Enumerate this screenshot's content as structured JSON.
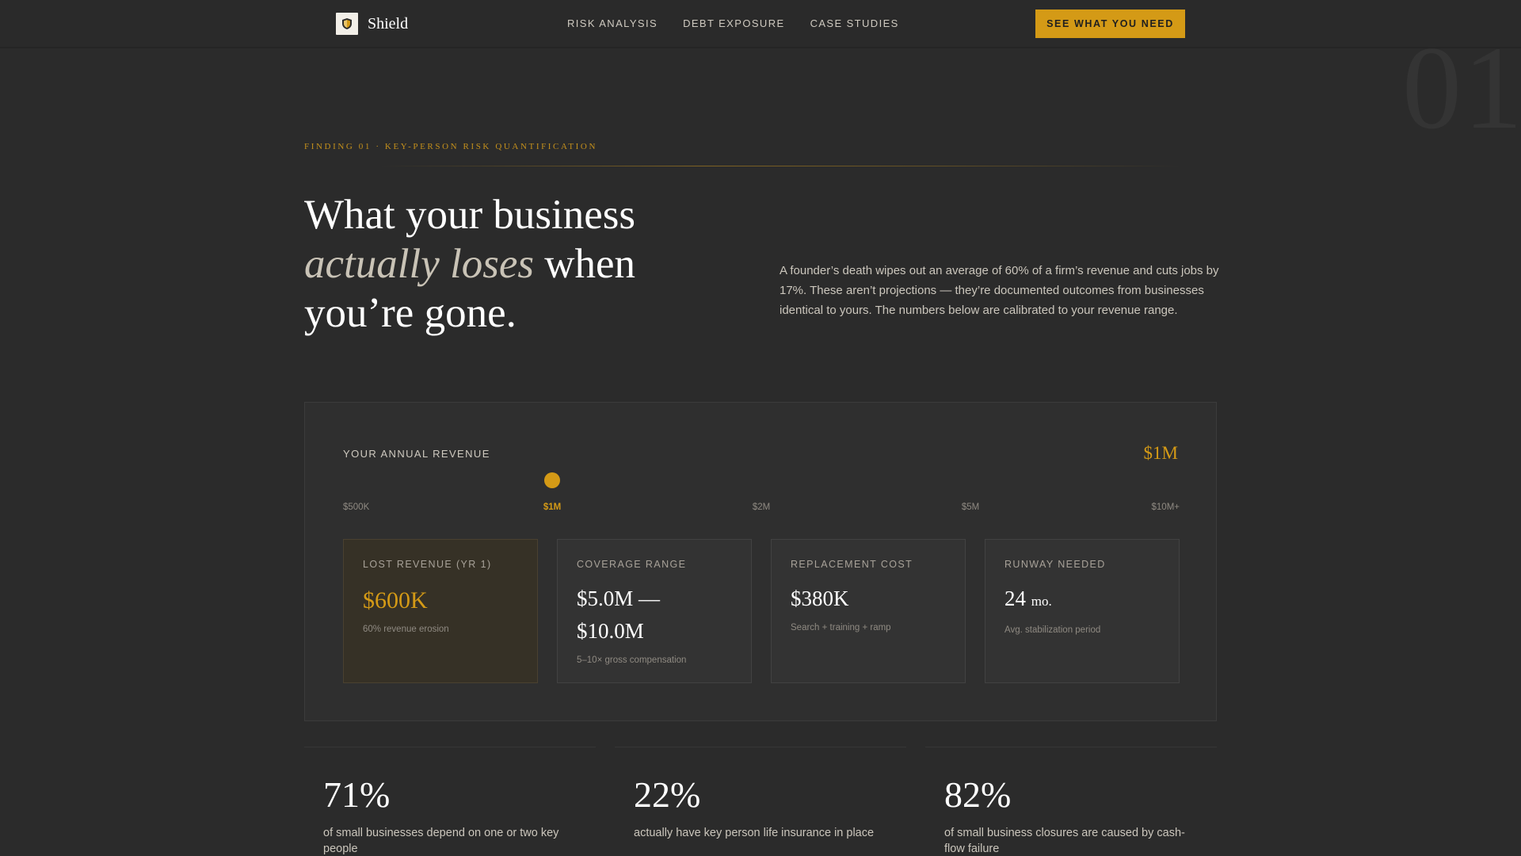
{
  "nav": {
    "brand": "Shield",
    "links": [
      "RISK ANALYSIS",
      "DEBT EXPOSURE",
      "CASE STUDIES"
    ],
    "cta": "SEE WHAT YOU NEED"
  },
  "ghost_number": "01",
  "section": {
    "eyebrow": "FINDING 01 · KEY-PERSON RISK QUANTIFICATION",
    "headline": {
      "line1": "What your business",
      "em": "actually loses",
      "line2_rest": " when",
      "line3": "you’re gone."
    },
    "intro": "A founder’s death wipes out an average of 60% of a firm’s revenue and cuts jobs by 17%. These aren’t projections — they’re documented outcomes from businesses identical to yours. The numbers below are calibrated to your revenue range."
  },
  "calculator": {
    "label": "YOUR ANNUAL REVENUE",
    "value": "$1M",
    "slider_position": 0.25,
    "ticks": [
      "$500K",
      "$1M",
      "$2M",
      "$5M",
      "$10M+"
    ],
    "active_tick": 1,
    "accent_color": "#d49a16",
    "cards": [
      {
        "label": "LOST REVENUE (YR 1)",
        "value": "$600K",
        "unit": "",
        "note": "60% revenue erosion",
        "highlight": true
      },
      {
        "label": "COVERAGE RANGE",
        "value": "$5.0M — $10.0M",
        "unit": "",
        "note": "5–10× gross compensation",
        "highlight": false
      },
      {
        "label": "REPLACEMENT COST",
        "value": "$380K",
        "unit": "",
        "note": "Search + training + ramp",
        "highlight": false
      },
      {
        "label": "RUNWAY NEEDED",
        "value": "24",
        "unit": "mo.",
        "note": "Avg. stabilization period",
        "highlight": false
      }
    ]
  },
  "stats": [
    {
      "value": "71%",
      "desc": "of small businesses depend on one or two key people"
    },
    {
      "value": "22%",
      "desc": "actually have key person life insurance in place"
    },
    {
      "value": "82%",
      "desc": "of small business closures are caused by cash-flow failure"
    }
  ],
  "icons": {
    "brand": "shield-icon"
  }
}
